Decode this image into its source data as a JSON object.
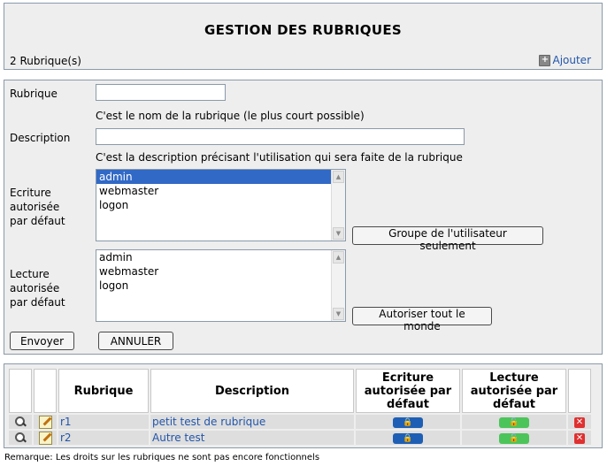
{
  "header": {
    "title": "GESTION DES RUBRIQUES",
    "count_text": "2 Rubrique(s)",
    "add_label": "Ajouter"
  },
  "form": {
    "rubrique_label": "Rubrique",
    "rubrique_value": "",
    "rubrique_hint": "C'est le nom de la rubrique (le plus court possible)",
    "description_label": "Description",
    "description_value": "",
    "description_hint": "C'est la description précisant l'utilisation qui sera faite de la rubrique",
    "ecriture_label": [
      "Ecriture",
      "autorisée",
      "par défaut"
    ],
    "ecriture_options": [
      "admin",
      "webmaster",
      "logon"
    ],
    "ecriture_selected": "admin",
    "groupe_button": "Groupe de l'utilisateur seulement",
    "lecture_label": [
      "Lecture",
      "autorisée",
      "par défaut"
    ],
    "lecture_options": [
      "admin",
      "webmaster",
      "logon"
    ],
    "lecture_selected": "",
    "autoriser_button": "Autoriser tout le monde",
    "submit_button": "Envoyer",
    "cancel_button": "ANNULER"
  },
  "table": {
    "headers": [
      "",
      "",
      "Rubrique",
      "Description",
      "Ecriture autorisée par défaut",
      "Lecture autorisée par défaut",
      ""
    ],
    "rows": [
      {
        "rubrique": "r1",
        "description": "petit test de rubrique"
      },
      {
        "rubrique": "r2",
        "description": "Autre test"
      }
    ]
  },
  "footnote": "Remarque: Les droits sur les rubriques ne sont pas encore fonctionnels",
  "colors": {
    "panel_bg": "#eeeeee",
    "link": "#2255aa",
    "selected": "#3169c6",
    "write_lock": "#1e5fb5",
    "read_lock": "#4cc45a",
    "delete": "#e03030"
  }
}
